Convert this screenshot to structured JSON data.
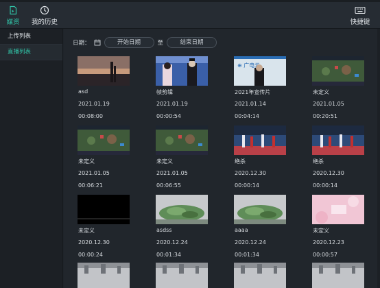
{
  "topbar": {
    "tabs": [
      {
        "label": "媒资",
        "icon": "document-icon",
        "active": true
      },
      {
        "label": "我的历史",
        "icon": "clock-icon",
        "active": false
      }
    ],
    "shortcut_label": "快捷键",
    "shortcut_icon": "keyboard-icon"
  },
  "sidebar": {
    "items": [
      {
        "label": "上传列表",
        "active": false
      },
      {
        "label": "直播列表",
        "active": true
      }
    ]
  },
  "filter": {
    "label": "日期：",
    "start_placeholder": "开始日期",
    "separator": "至",
    "end_placeholder": "结束日期"
  },
  "videos": [
    {
      "title": "asd",
      "date": "2021.01.19",
      "duration": "00:08:00",
      "thumb": "sunset"
    },
    {
      "title": "帧剪辑",
      "date": "2021.01.19",
      "duration": "00:00:54",
      "thumb": "stage"
    },
    {
      "title": "2021年宣传片",
      "date": "2021.01.14",
      "duration": "00:04:14",
      "thumb": "presentation"
    },
    {
      "title": "未定义",
      "date": "2021.01.05",
      "duration": "00:20:51",
      "thumb": "game"
    },
    {
      "title": "未定义",
      "date": "2021.01.05",
      "duration": "00:06:21",
      "thumb": "game"
    },
    {
      "title": "未定义",
      "date": "2021.01.05",
      "duration": "00:06:55",
      "thumb": "game"
    },
    {
      "title": "绝杀",
      "date": "2020.12.30",
      "duration": "00:00:14",
      "thumb": "basketball"
    },
    {
      "title": "绝杀",
      "date": "2020.12.30",
      "duration": "00:00:14",
      "thumb": "basketball"
    },
    {
      "title": "未定义",
      "date": "2020.12.30",
      "duration": "00:00:24",
      "thumb": "black"
    },
    {
      "title": "asdss",
      "date": "2020.12.24",
      "duration": "00:01:34",
      "thumb": "forest"
    },
    {
      "title": "aaaa",
      "date": "2020.12.24",
      "duration": "00:01:34",
      "thumb": "forest"
    },
    {
      "title": "未定义",
      "date": "2020.12.23",
      "duration": "00:00:57",
      "thumb": "pink"
    }
  ],
  "partial_row_thumbs": [
    "city",
    "city",
    "city",
    "city"
  ]
}
